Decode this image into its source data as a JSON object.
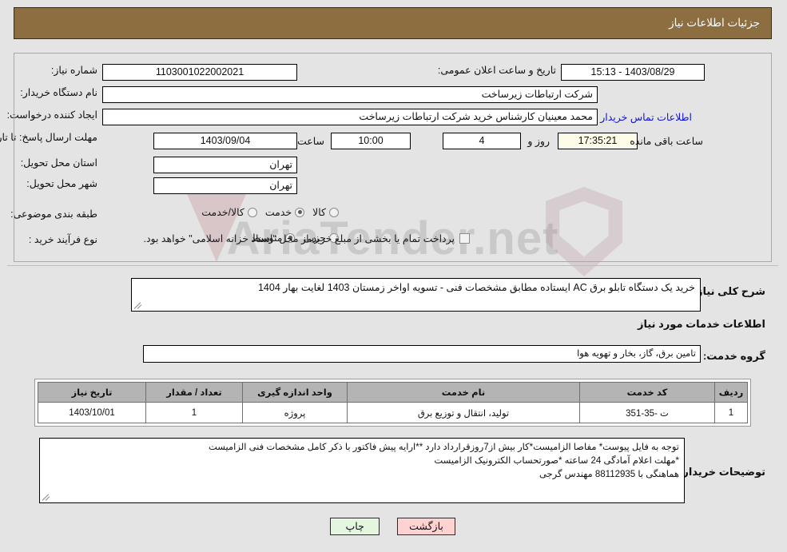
{
  "header": {
    "title": "جزئیات اطلاعات نیاز"
  },
  "info": {
    "need_number_label": "شماره نیاز:",
    "need_number_value": "1103001022002021",
    "announce_datetime_label": "تاریخ و ساعت اعلان عمومی:",
    "announce_datetime_value": "1403/08/29 - 15:13",
    "buyer_org_label": "نام دستگاه خریدار:",
    "buyer_org_value": "شرکت ارتباطات زیرساخت",
    "requester_label": "ایجاد کننده درخواست:",
    "requester_value": "محمد معینیان کارشناس خرید شرکت ارتباطات زیرساخت",
    "contact_link": "اطلاعات تماس خریدار",
    "deadline_label": "مهلت ارسال پاسخ: تا تاریخ:",
    "deadline_date": "1403/09/04",
    "deadline_time_label": "ساعت",
    "deadline_time": "10:00",
    "remaining_days": "4",
    "remaining_days_label": "روز و",
    "remaining_time": "17:35:21",
    "remaining_time_label": "ساعت باقی مانده",
    "province_label": "استان محل تحویل:",
    "province_value": "تهران",
    "city_label": "شهر محل تحویل:",
    "city_value": "تهران",
    "category_label": "طبقه بندی موضوعی:",
    "category_options": [
      {
        "label": "کالا",
        "selected": false
      },
      {
        "label": "خدمت",
        "selected": true
      },
      {
        "label": "کالا/خدمت",
        "selected": false
      }
    ],
    "process_label": "نوع فرآیند خرید :",
    "process_options": [
      {
        "label": "جزیی",
        "selected": false
      },
      {
        "label": "متوسط",
        "selected": true
      }
    ],
    "treasury_checkbox_label": "پرداخت تمام یا بخشی از مبلغ خرید،از محل \"اسناد خزانه اسلامی\" خواهد بود.",
    "treasury_checked": false
  },
  "summary": {
    "label": "شرح کلی نیاز:",
    "text": "خرید یک دستگاه تابلو برق AC ایستاده مطابق مشخصات فنی -          تسویه اواخر زمستان 1403 لغایت بهار 1404"
  },
  "services": {
    "heading": "اطلاعات خدمات مورد نیاز",
    "group_label": "گروه خدمت:",
    "group_value": "تامین برق، گاز، بخار و تهویه هوا",
    "columns": [
      "ردیف",
      "کد خدمت",
      "نام خدمت",
      "واحد اندازه گیری",
      "تعداد / مقدار",
      "تاریخ نیاز"
    ],
    "rows": [
      {
        "radif": "1",
        "code": "ت -35-351",
        "name": "تولید، انتقال و توزیع برق",
        "unit": "پروژه",
        "qty": "1",
        "date": "1403/10/01"
      }
    ]
  },
  "notes": {
    "label": "توضیحات خریدار:",
    "lines": [
      "توجه به فایل پیوست* مفاصا الزامیست*کار بیش از7روزقرارداد دارد **ارایه پیش فاکتور با ذکر کامل مشخصات فنی الزامیست",
      "*مهلت اعلام آمادگی 24 ساعته *صورتحساب الکترونیک الزامیست",
      "هماهنگی با 88112935 مهندس گرجی"
    ]
  },
  "buttons": {
    "print": "چاپ",
    "back": "بازگشت"
  },
  "watermark": {
    "text": "AriaTender.net"
  },
  "colors": {
    "header_brown": "#8d6e41",
    "link_blue": "#1414cc",
    "table_header_gray": "#b4b4b4",
    "timer_bg": "#fcfce9",
    "back_btn_bg": "#ffd2d2",
    "print_btn_bg": "#e4f5e0",
    "page_bg": "#e4e4e4"
  }
}
